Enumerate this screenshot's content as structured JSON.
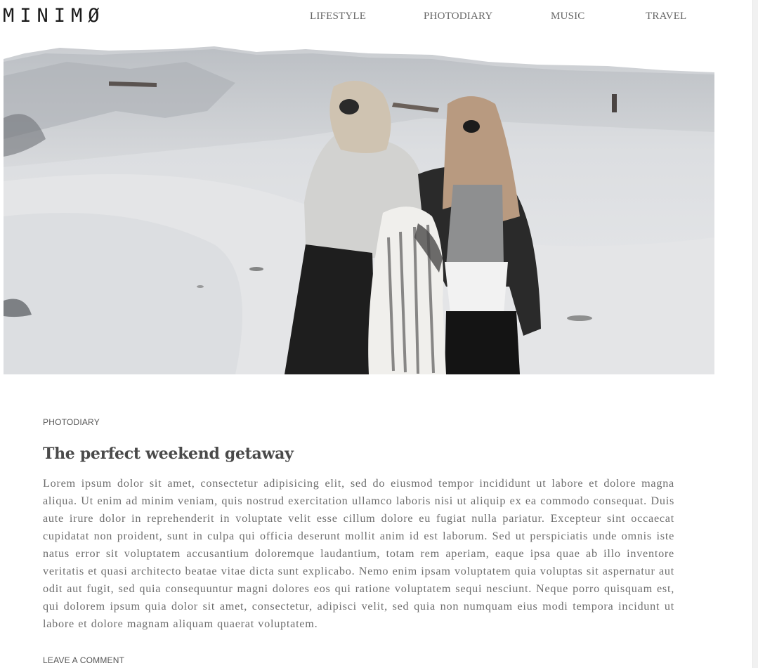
{
  "site": {
    "logo": "MINIMØ"
  },
  "nav": {
    "items": [
      {
        "label": "LIFESTYLE"
      },
      {
        "label": "PHOTODIARY"
      },
      {
        "label": "MUSIC"
      },
      {
        "label": "TRAVEL"
      }
    ]
  },
  "post": {
    "category": "PHOTODIARY",
    "title": "The perfect weekend getaway",
    "body": "Lorem ipsum dolor sit amet, consectetur adipisicing elit, sed do eiusmod tempor incididunt ut labore et dolore magna aliqua. Ut enim ad minim veniam, quis nostrud exercitation ullamco laboris nisi ut aliquip ex ea commodo consequat. Duis aute irure dolor in reprehenderit in voluptate velit esse cillum dolore eu fugiat nulla pariatur. Excepteur sint occaecat cupidatat non proident, sunt in culpa qui officia deserunt mollit anim id est laborum. Sed ut perspiciatis unde omnis iste natus error sit voluptatem accusantium doloremque laudantium, totam rem aperiam, eaque ipsa quae ab illo inventore veritatis et quasi architecto beatae vitae dicta sunt explicabo. Nemo enim ipsam voluptatem quia voluptas sit aspernatur aut odit aut fugit, sed quia consequuntur magni dolores eos qui ratione voluptatem sequi nesciunt. Neque porro quisquam est, qui dolorem ipsum quia dolor sit amet, consectetur, adipisci velit, sed quia non numquam eius modi tempora incidunt ut labore et dolore magnam aliquam quaerat voluptatem.",
    "comment_link": "LEAVE A COMMENT"
  }
}
